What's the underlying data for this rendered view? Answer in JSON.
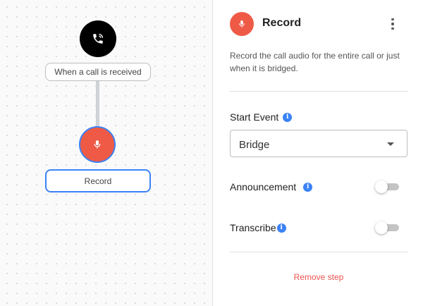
{
  "canvas": {
    "trigger_node": {
      "icon": "phone-call-icon",
      "label": "When a call is received",
      "color": "#000000"
    },
    "record_node": {
      "icon": "microphone-icon",
      "label": "Record",
      "color": "#ef5a46",
      "selected_border_color": "#3b82f6"
    }
  },
  "panel": {
    "icon": "microphone-icon",
    "title": "Record",
    "menu_icon": "more-vertical-icon",
    "description": "Record the call audio for the entire call or just when it is bridged.",
    "start_event": {
      "label": "Start Event",
      "info_icon": "info-icon",
      "selected": "Bridge"
    },
    "announcement": {
      "label": "Announcement",
      "info_icon": "info-icon",
      "enabled": false
    },
    "transcribe": {
      "label": "Transcribe",
      "info_icon": "info-icon",
      "enabled": false
    },
    "remove_label": "Remove step",
    "accent_color": "#3b82f6",
    "danger_color": "#ef5350"
  }
}
